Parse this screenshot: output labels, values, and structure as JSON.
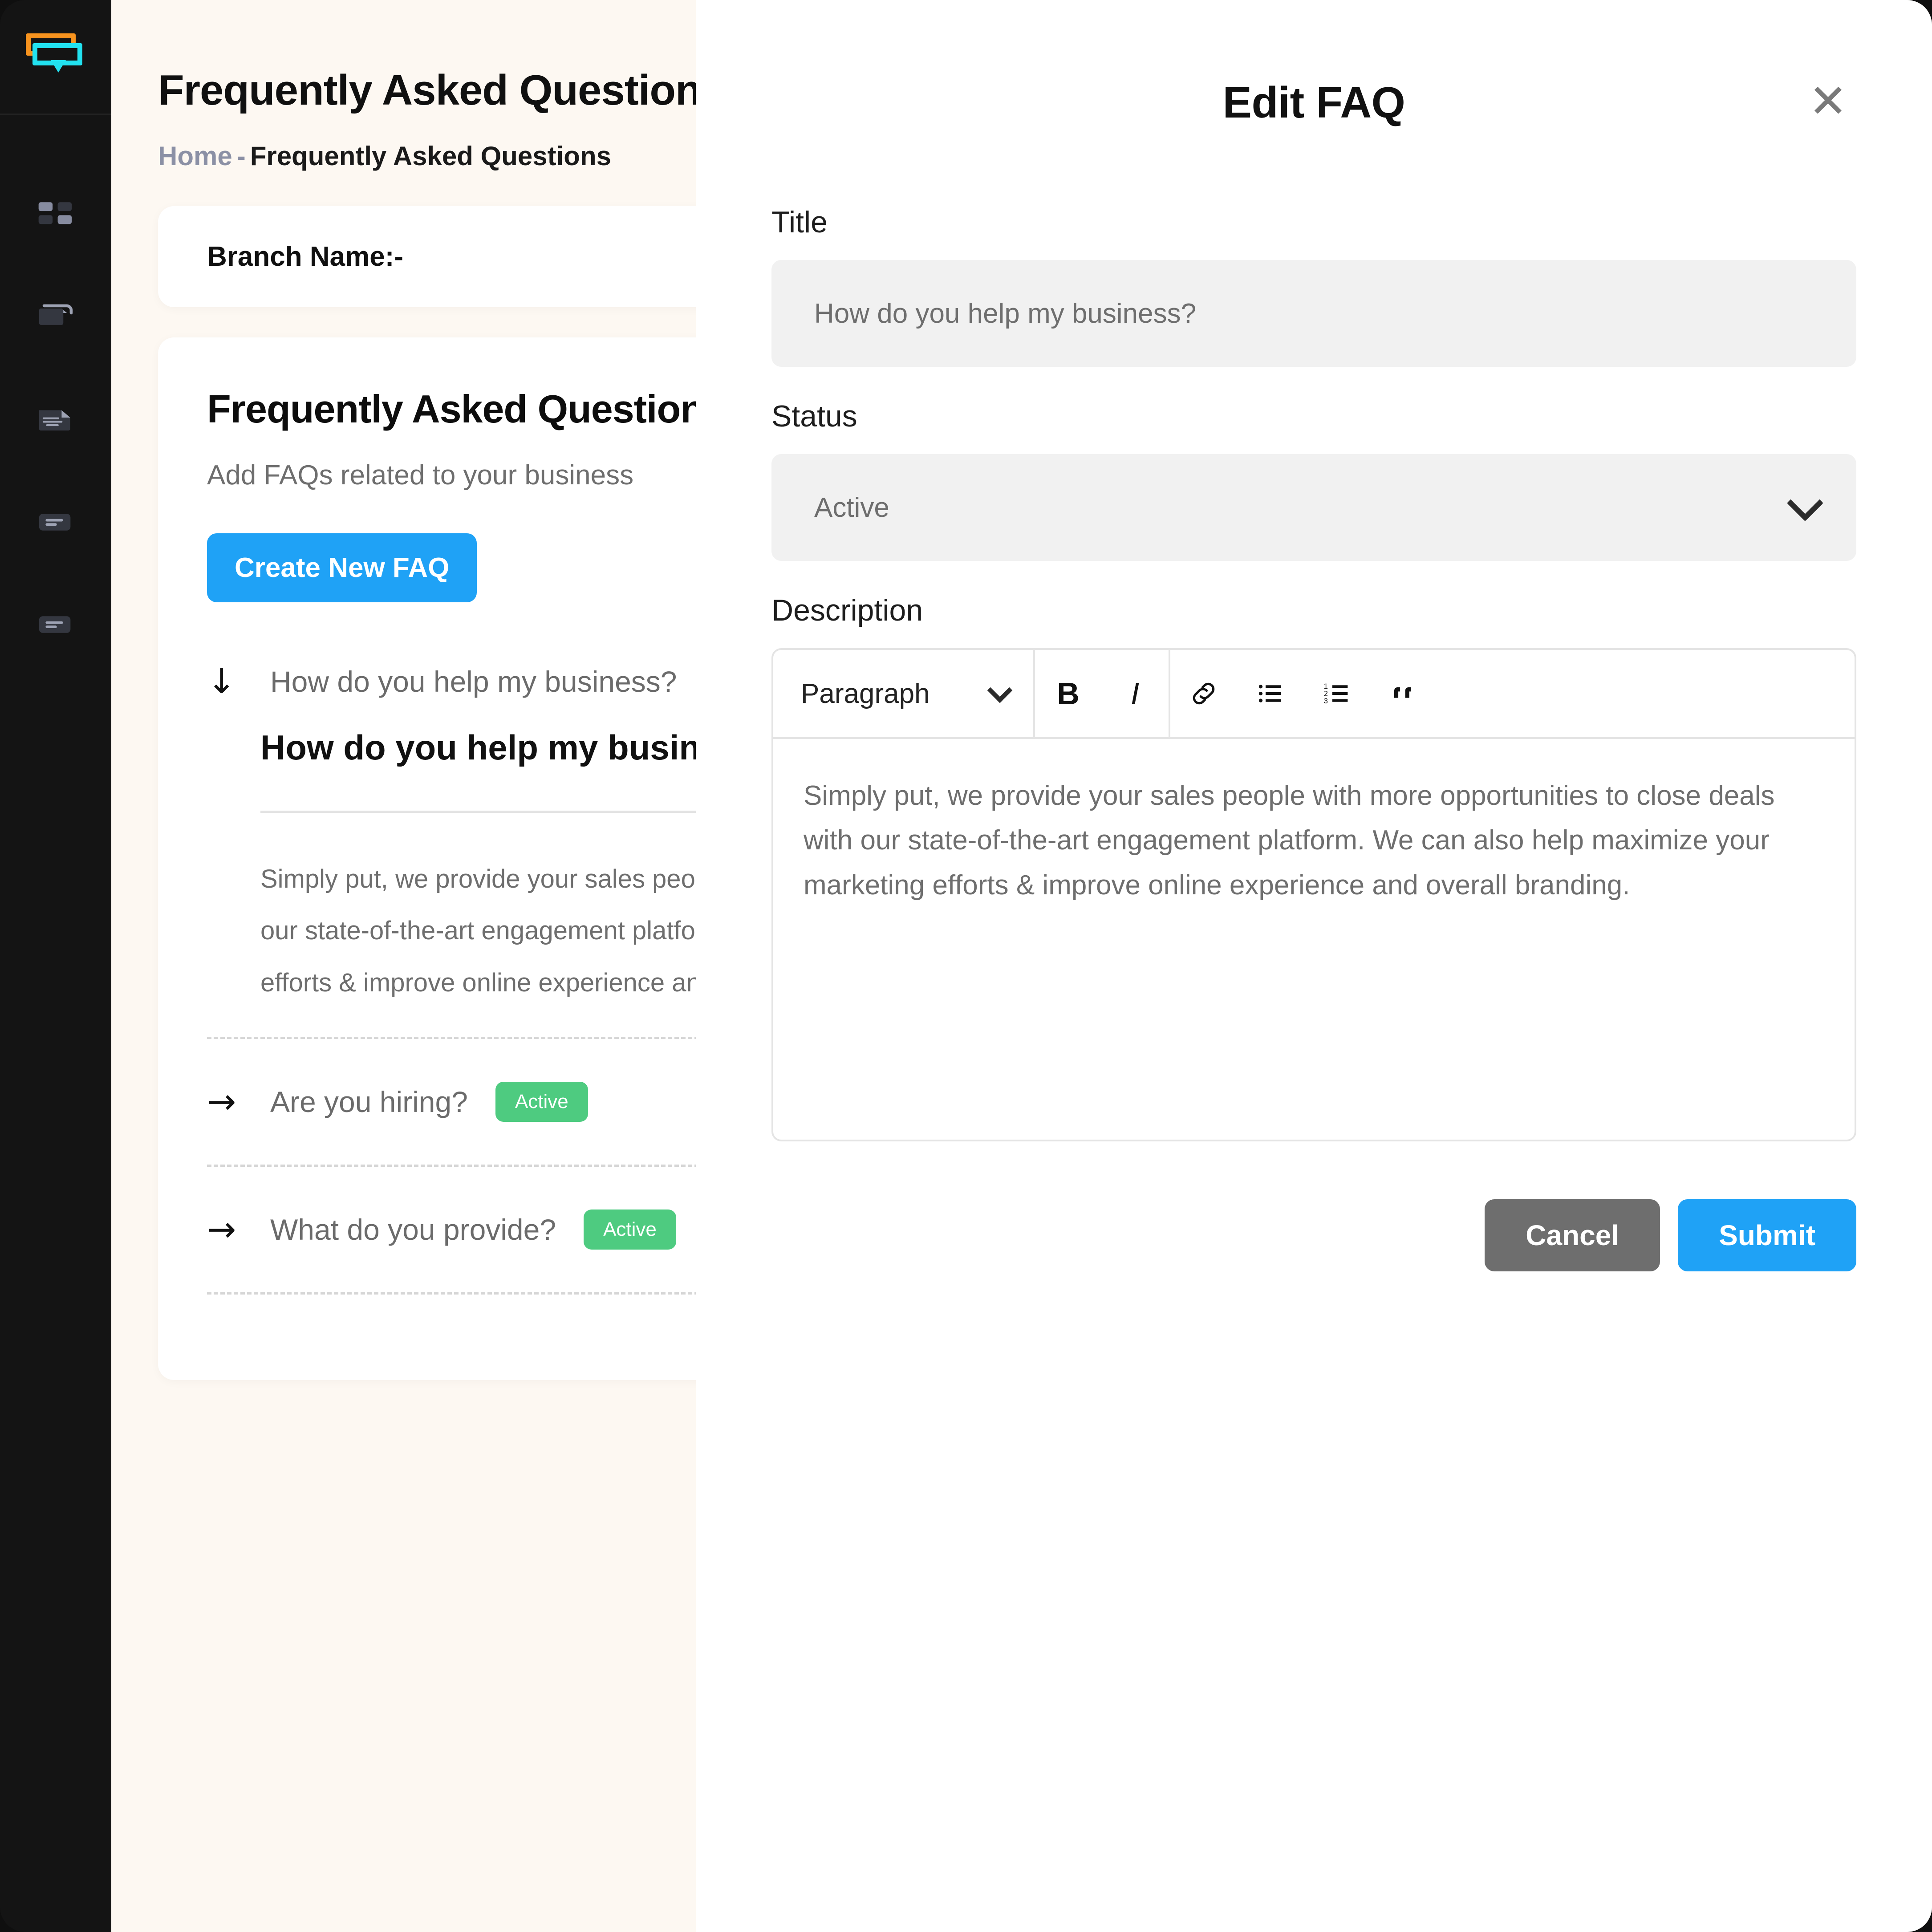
{
  "sidebar": {
    "logo_name": "chat-bubbles-logo",
    "logo_colors": {
      "orange": "#F7931E",
      "cyan": "#22E2F0"
    },
    "items": [
      {
        "icon": "grid-dashboard-icon"
      },
      {
        "icon": "folder-icon"
      },
      {
        "icon": "document-text-icon"
      },
      {
        "icon": "list-card-icon"
      },
      {
        "icon": "list-card-alt-icon"
      }
    ]
  },
  "page": {
    "title": "Frequently Asked Questions",
    "breadcrumb": {
      "home": "Home",
      "separator": "-",
      "current": "Frequently Asked Questions"
    },
    "branch_card": {
      "label": "Branch Name:-"
    },
    "faq_card": {
      "heading": "Frequently Asked Questions",
      "subtitle": "Add FAQs related to your business",
      "create_button": "Create New FAQ",
      "items": [
        {
          "arrow": "↓",
          "question": "How do you help my business?",
          "expanded": true,
          "detail_title": "How do you help my business?",
          "detail_lines": [
            "Simply put, we provide your sales people with more opportunities to close deals with",
            "our state-of-the-art engagement platform. We can also help maximize your marketing",
            "efforts & improve online experience and overall branding."
          ]
        },
        {
          "arrow": "→",
          "question": "Are you hiring?",
          "status": "Active",
          "expanded": false
        },
        {
          "arrow": "→",
          "question": "What do you provide?",
          "status": "Active",
          "expanded": false
        }
      ]
    }
  },
  "modal": {
    "title": "Edit FAQ",
    "close_icon": "✕",
    "title_field": {
      "label": "Title",
      "value": "How do you help my business?"
    },
    "status_field": {
      "label": "Status",
      "value": "Active",
      "chevron": "chevron-down-icon"
    },
    "description_field": {
      "label": "Description",
      "toolbar": {
        "block_format": "Paragraph",
        "bold": "B",
        "italic": "I",
        "link": "link-icon",
        "bullet_list": "bullet-list-icon",
        "numbered_list": "numbered-list-icon",
        "blockquote": "blockquote-icon"
      },
      "content": "Simply put, we provide your sales people with more opportunities to close deals with our state-of-the-art engagement platform. We can also help maximize your marketing efforts & improve online experience and overall branding."
    },
    "cancel_button": "Cancel",
    "submit_button": "Submit"
  },
  "colors": {
    "accent_blue": "#1FA2F6",
    "success_green": "#4ECB80",
    "sidebar_dark": "#141414",
    "page_bg": "#FDF8F2"
  }
}
